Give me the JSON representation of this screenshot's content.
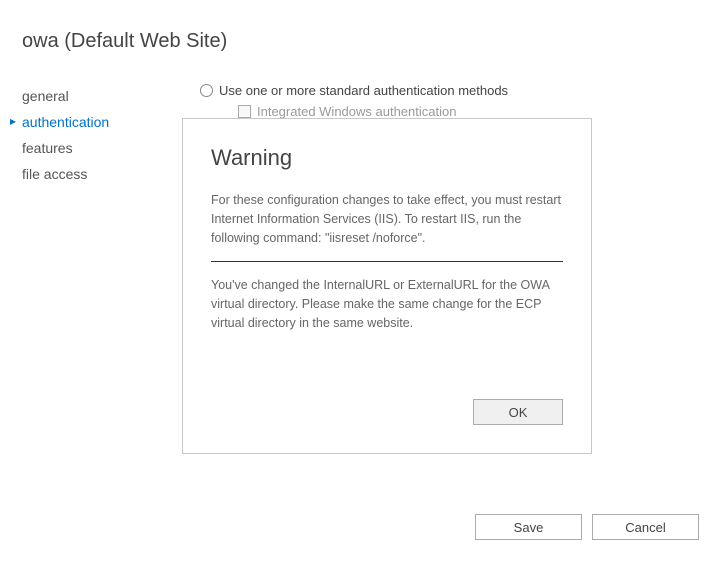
{
  "title": "owa (Default Web Site)",
  "sidebar": {
    "items": [
      {
        "label": "general"
      },
      {
        "label": "authentication"
      },
      {
        "label": "features"
      },
      {
        "label": "file access"
      }
    ],
    "selected_index": 1
  },
  "auth": {
    "radio_label": "Use one or more standard authentication methods",
    "checkbox_label": "Integrated Windows authentication"
  },
  "dialog": {
    "title": "Warning",
    "message1": "For these configuration changes to take effect, you must restart Internet Information Services (IIS). To restart IIS, run the following command: \"iisreset /noforce\".",
    "message2": "You've changed the InternalURL or ExternalURL for the OWA virtual directory. Please make the same change for the ECP virtual directory in the same website.",
    "ok_label": "OK"
  },
  "buttons": {
    "save": "Save",
    "cancel": "Cancel"
  }
}
